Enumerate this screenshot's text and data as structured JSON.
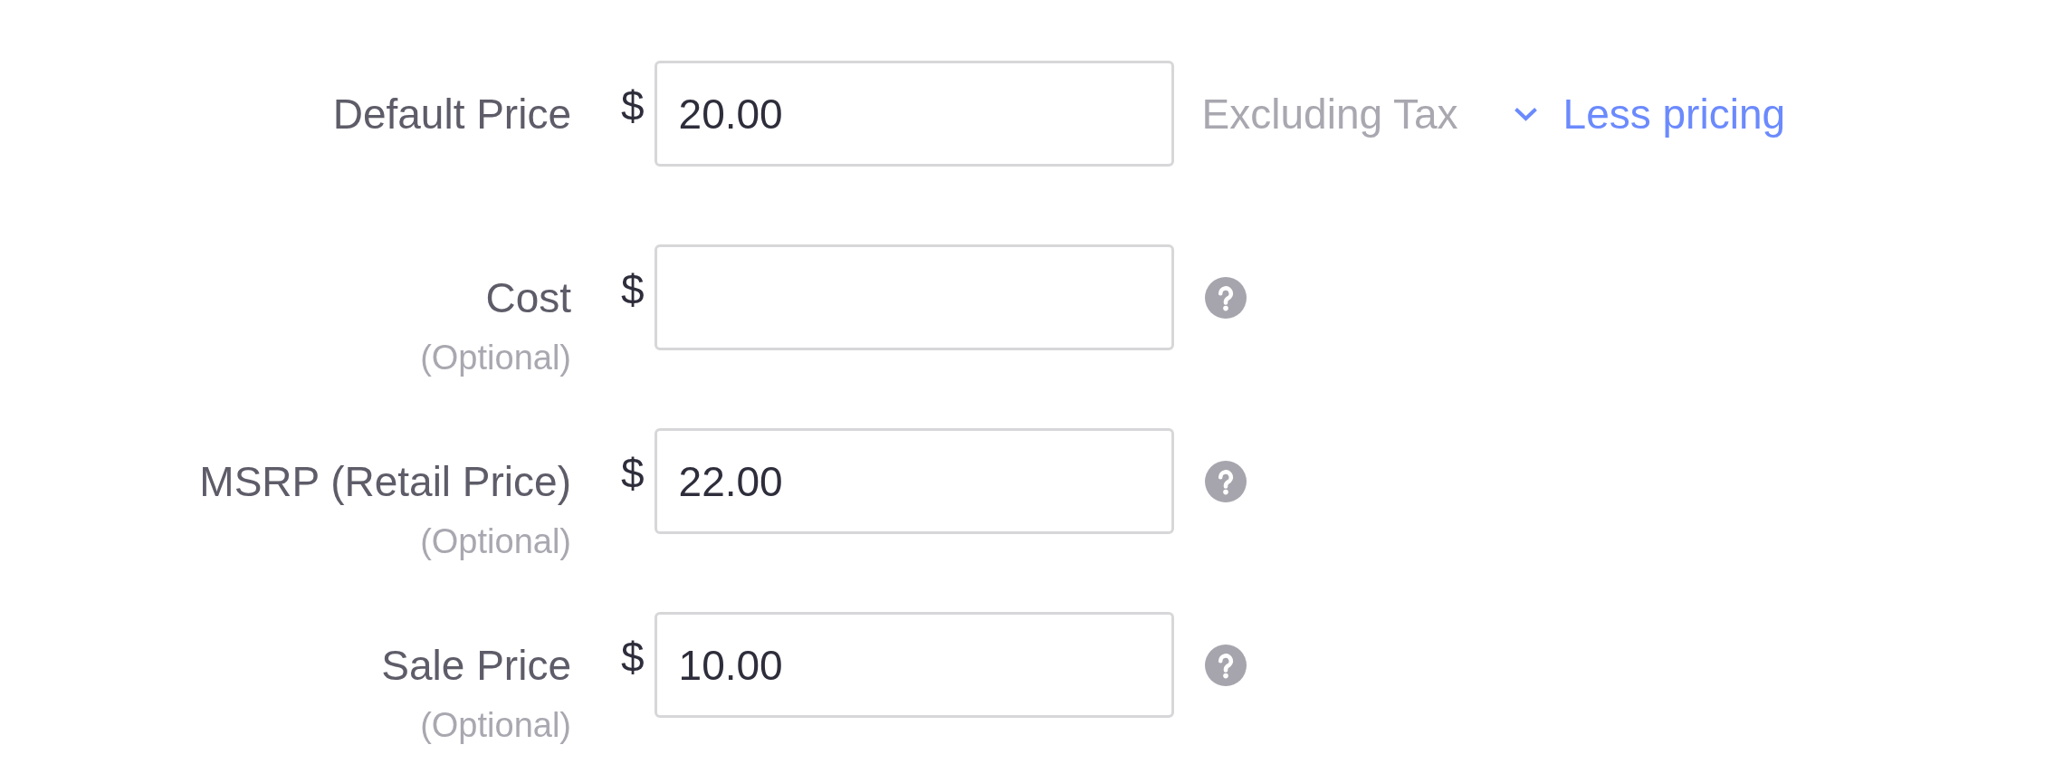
{
  "fields": [
    {
      "label": "Default Price",
      "currency": "$",
      "value": "20.00",
      "kind": "note",
      "note": "Excluding Tax",
      "link": {
        "label": "Less pricing",
        "expanded": true
      }
    },
    {
      "label": "Cost",
      "optional": "(Optional)",
      "currency": "$",
      "kind": "help"
    },
    {
      "label": "MSRP (Retail Price)",
      "optional": "(Optional)",
      "currency": "$",
      "value": "22.00",
      "kind": "help"
    },
    {
      "label": "Sale Price",
      "optional": "(Optional)",
      "currency": "$",
      "value": "10.00",
      "kind": "help"
    }
  ]
}
